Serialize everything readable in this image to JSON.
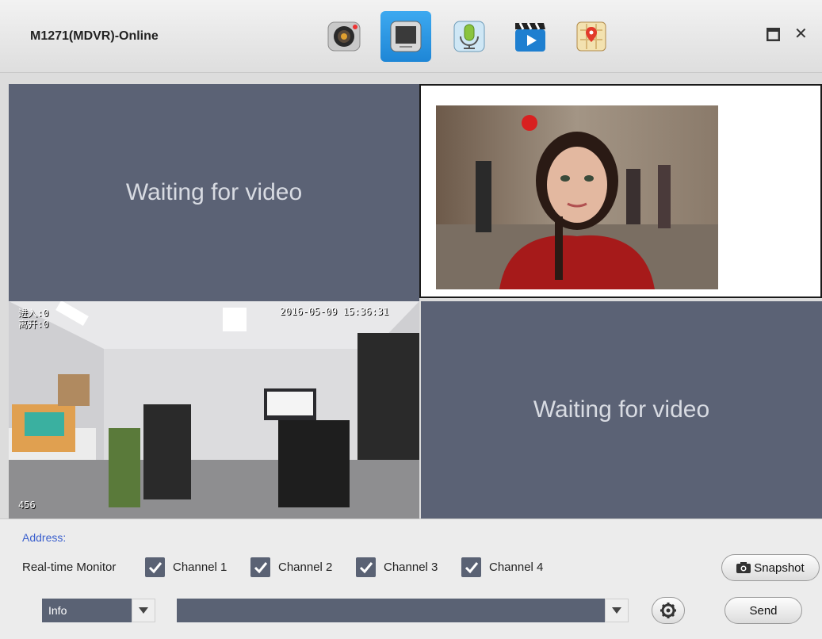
{
  "window": {
    "title": "M1271(MDVR)-Online",
    "toolbar": [
      {
        "icon": "camera-icon",
        "active": false
      },
      {
        "icon": "monitor-icon",
        "active": true
      },
      {
        "icon": "microphone-icon",
        "active": false
      },
      {
        "icon": "clapperboard-icon",
        "active": false
      },
      {
        "icon": "map-icon",
        "active": false
      }
    ],
    "controls": {
      "maximize": "🗖",
      "close": "✕"
    }
  },
  "video": {
    "cells": [
      {
        "channel": 1,
        "state": "waiting",
        "text": "Waiting for video"
      },
      {
        "channel": 2,
        "state": "playing",
        "content": "portrait image"
      },
      {
        "channel": 3,
        "state": "playing",
        "content": "office camera",
        "osd_top_left_1": "进入:0",
        "osd_top_left_2": "离开:0",
        "osd_timestamp": "2016-05-09 15:36:31",
        "osd_bottom_left": "456"
      },
      {
        "channel": 4,
        "state": "waiting",
        "text": "Waiting for video"
      }
    ]
  },
  "panel": {
    "address_label": "Address:",
    "monitor_label": "Real-time Monitor",
    "channels": [
      {
        "label": "Channel 1",
        "checked": true
      },
      {
        "label": "Channel 2",
        "checked": true
      },
      {
        "label": "Channel 3",
        "checked": true
      },
      {
        "label": "Channel 4",
        "checked": true
      }
    ],
    "snapshot_label": "Snapshot",
    "info_select": "Info",
    "command_select": "",
    "send_label": "Send"
  },
  "colors": {
    "accent": "#1e86d6",
    "video_placeholder": "#5b6275",
    "checkbox": "#5a6274",
    "address_text": "#3a5fcd"
  }
}
